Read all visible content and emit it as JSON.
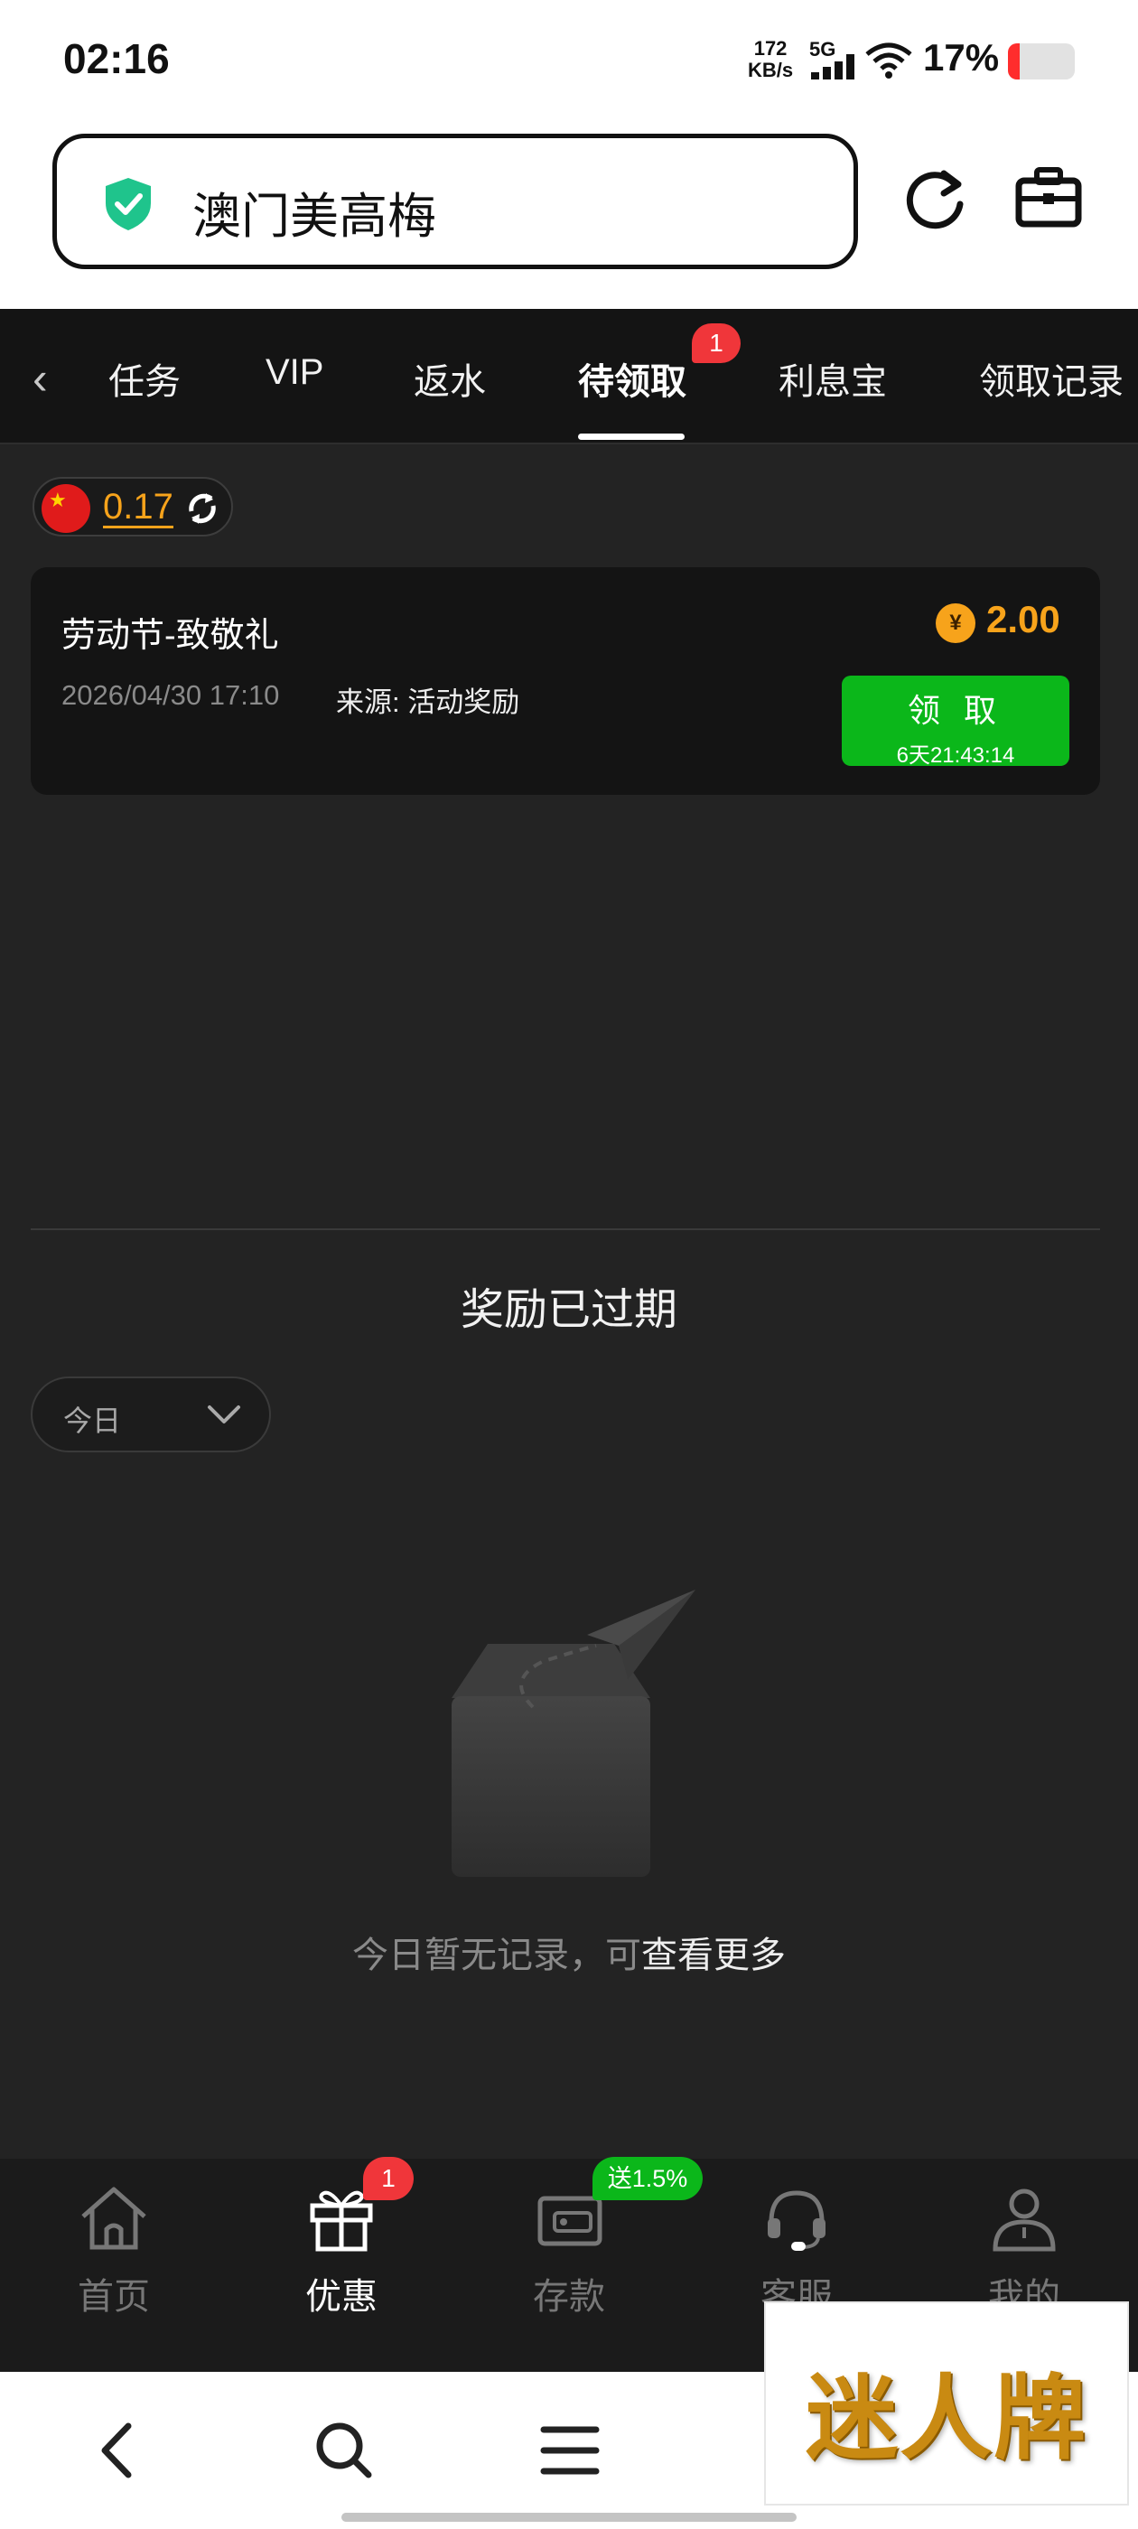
{
  "status_bar": {
    "time": "02:16",
    "net_speed_value": "172",
    "net_speed_unit": "KB/s",
    "network_type": "5G",
    "battery_percent": "17%",
    "battery_level": 0.17,
    "battery_color": "#ff2d2d"
  },
  "browser": {
    "url_text": "澳门美高梅",
    "secure_icon": "shield-check-icon",
    "reload_icon": "reload-icon",
    "toolbox_icon": "toolbox-icon"
  },
  "tabs": {
    "back_icon": "chevron-left-icon",
    "items": [
      {
        "label": "任务"
      },
      {
        "label": "VIP"
      },
      {
        "label": "返水"
      },
      {
        "label": "待领取",
        "active": true,
        "badge": "1"
      },
      {
        "label": "利息宝"
      },
      {
        "label": "领取记录"
      }
    ]
  },
  "balance": {
    "currency_flag": "china-flag-icon",
    "value": "0.17",
    "refresh_icon": "refresh-icon"
  },
  "reward": {
    "title": "劳动节-致敬礼",
    "date": "2026/04/30 17:10",
    "source": "来源: 活动奖励",
    "coin_symbol": "¥",
    "amount": "2.00",
    "claim_label": "领 取",
    "countdown": "6天21:43:14"
  },
  "expired_section": {
    "title": "奖励已过期",
    "filter_value": "今日",
    "empty_text_prefix": "今日暂无记录，可",
    "empty_text_link": "查看更多"
  },
  "bottom_nav": {
    "items": [
      {
        "label": "首页",
        "icon": "home-icon"
      },
      {
        "label": "优惠",
        "icon": "gift-icon",
        "active": true,
        "badge": "1"
      },
      {
        "label": "存款",
        "icon": "wallet-icon",
        "badge": "送1.5%"
      },
      {
        "label": "客服",
        "icon": "headset-icon"
      },
      {
        "label": "我的",
        "icon": "user-icon"
      }
    ]
  },
  "watermark": {
    "text": "迷人牌"
  },
  "colors": {
    "accent_orange": "#f7a31b",
    "accent_green": "#0bb71a",
    "badge_red": "#f0363a"
  }
}
